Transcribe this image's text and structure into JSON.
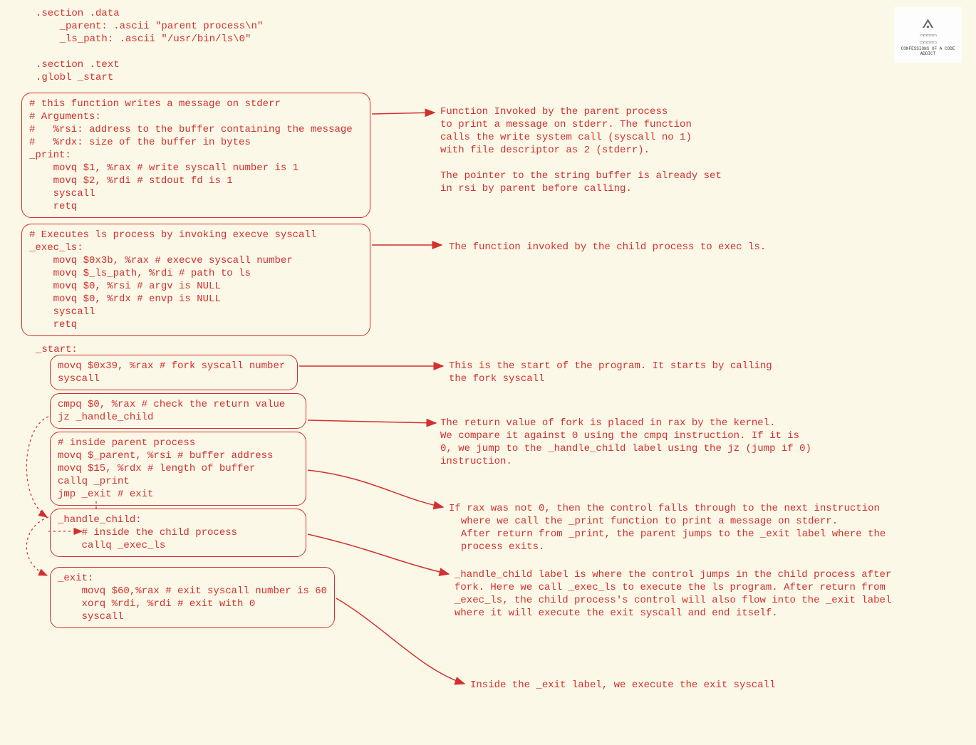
{
  "logo": {
    "caption": "CONFESSIONS OF A CODE ADDICT"
  },
  "header_code": ".section .data\n    _parent: .ascii \"parent process\\n\"\n    _ls_path: .ascii \"/usr/bin/ls\\0\"\n\n.section .text\n.globl _start",
  "box_print": "# this function writes a message on stderr\n# Arguments:\n#   %rsi: address to the buffer containing the message\n#   %rdx: size of the buffer in bytes\n_print:\n    movq $1, %rax # write syscall number is 1\n    movq $2, %rdi # stdout fd is 1\n    syscall\n    retq",
  "box_exec": "# Executes ls process by invoking execve syscall\n_exec_ls:\n    movq $0x3b, %rax # execve syscall number\n    movq $_ls_path, %rdi # path to ls\n    movq $0, %rsi # argv is NULL\n    movq $0, %rdx # envp is NULL\n    syscall\n    retq",
  "start_label": "_start:",
  "box_fork": "movq $0x39, %rax # fork syscall number\nsyscall",
  "box_cmp": "cmpq $0, %rax # check the return value\njz _handle_child",
  "box_parent": "# inside parent process\nmovq $_parent, %rsi # buffer address\nmovq $15, %rdx # length of buffer\ncallq _print\njmp _exit # exit",
  "box_child": "_handle_child:\n    # inside the child process\n    callq _exec_ls",
  "box_exit": "_exit:\n    movq $60,%rax # exit syscall number is 60\n    xorq %rdi, %rdi # exit with 0\n    syscall",
  "ann_print": "Function Invoked by the parent process\nto print a message on stderr. The function\ncalls the write system call (syscall no 1)\nwith file descriptor as 2 (stderr).\n\nThe pointer to the string buffer is already set\nin rsi by parent before calling.",
  "ann_exec": "The function invoked by the child process to exec ls.",
  "ann_fork": "This is the start of the program. It starts by calling\nthe fork syscall",
  "ann_cmp": "The return value of fork is placed in rax by the kernel.\nWe compare it against 0 using the cmpq instruction. If it is\n0, we jump to the _handle_child label using the jz (jump if 0)\ninstruction.",
  "ann_parent": "If rax was not 0, then the control falls through to the next instruction\n  where we call the _print function to print a message on stderr.\n  After return from _print, the parent jumps to the _exit label where the\n  process exits.",
  "ann_child": "_handle_child label is where the control jumps in the child process after\nfork. Here we call _exec_ls to execute the ls program. After return from\n_exec_ls, the child process's control will also flow into the _exit label\nwhere it will execute the exit syscall and end itself.",
  "ann_exit": "Inside the _exit label, we execute the exit syscall"
}
